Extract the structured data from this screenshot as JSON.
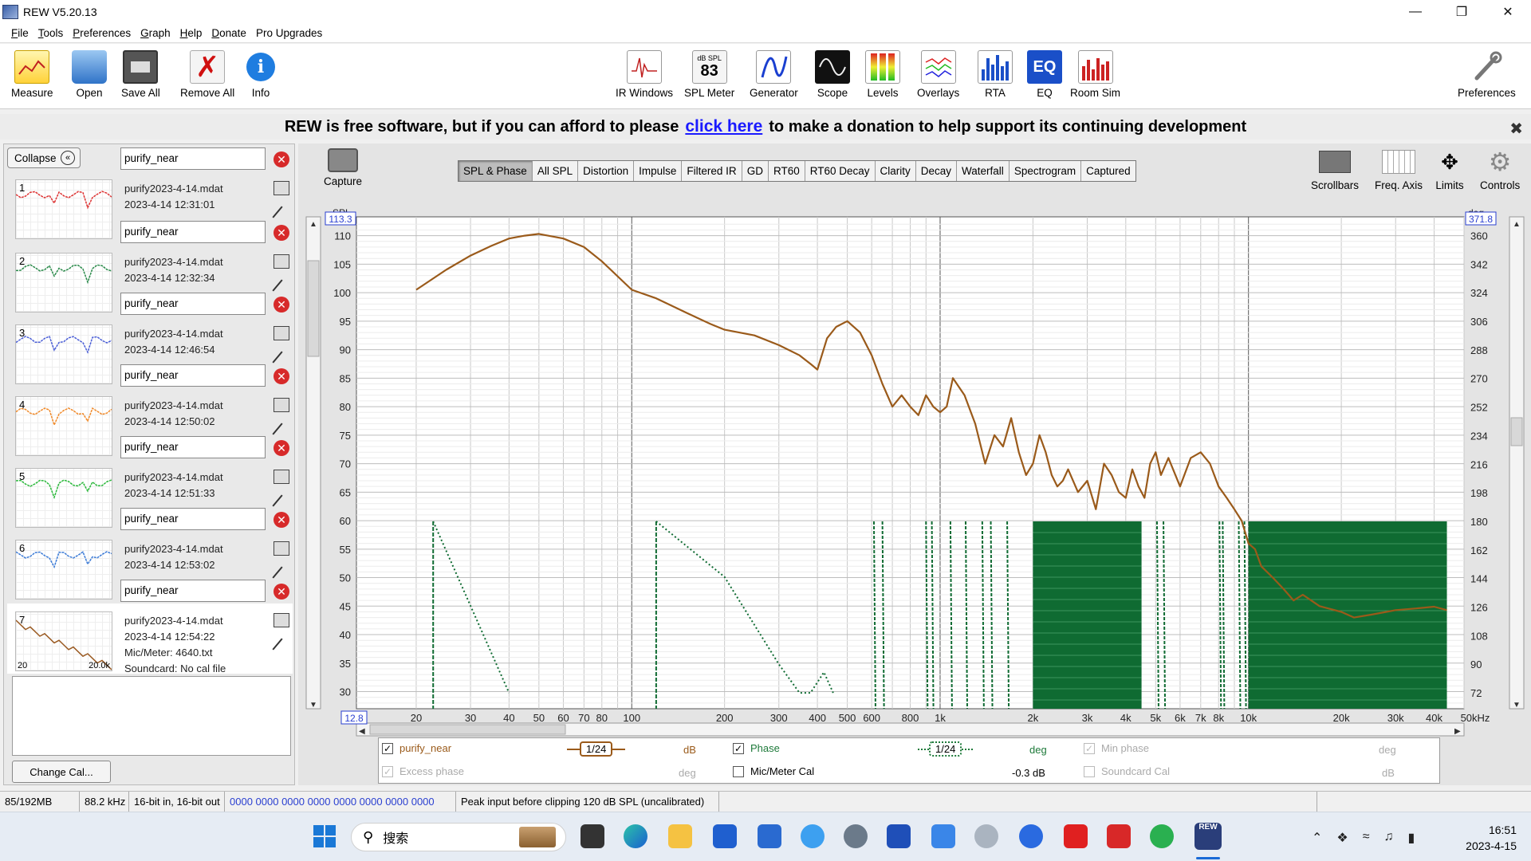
{
  "window": {
    "title": "REW V5.20.13"
  },
  "menu": [
    {
      "label": "File",
      "u": "F",
      "rest": "ile"
    },
    {
      "label": "Tools",
      "u": "T",
      "rest": "ools"
    },
    {
      "label": "Preferences",
      "u": "P",
      "rest": "references"
    },
    {
      "label": "Graph",
      "u": "G",
      "rest": "raph"
    },
    {
      "label": "Help",
      "u": "H",
      "rest": "elp"
    },
    {
      "label": "Donate",
      "u": "D",
      "rest": "onate"
    },
    {
      "label": "Pro Upgrades",
      "u": "",
      "rest": "Pro Upgrades"
    }
  ],
  "toolbar": {
    "measure": "Measure",
    "open": "Open",
    "save_all": "Save All",
    "remove_all": "Remove All",
    "info": "Info",
    "ir_windows": "IR Windows",
    "spl_meter": "SPL Meter",
    "spl_top": "dB SPL",
    "spl_value": "83",
    "generator": "Generator",
    "scope": "Scope",
    "levels": "Levels",
    "overlays": "Overlays",
    "rta": "RTA",
    "eq": "EQ",
    "eq_icon_text": "EQ",
    "room_sim": "Room Sim",
    "preferences": "Preferences"
  },
  "donate": {
    "before": "REW is free software, but if you can afford to please",
    "link": "click here",
    "after": "to make a donation to help support its continuing development"
  },
  "left": {
    "collapse": "Collapse",
    "change_cal": "Change Cal...",
    "measurements": [
      {
        "num": "1",
        "name": "purify_near",
        "file": "purify2023-4-14.mdat",
        "date": "2023-4-14 12:31:01",
        "color": "#d33"
      },
      {
        "num": "2",
        "name": "purify_near",
        "file": "purify2023-4-14.mdat",
        "date": "2023-4-14 12:32:34",
        "color": "#2a8a4a"
      },
      {
        "num": "3",
        "name": "purify_near",
        "file": "purify2023-4-14.mdat",
        "date": "2023-4-14 12:46:54",
        "color": "#4b5fd6"
      },
      {
        "num": "4",
        "name": "purify_near",
        "file": "purify2023-4-14.mdat",
        "date": "2023-4-14 12:50:02",
        "color": "#f08a2a"
      },
      {
        "num": "5",
        "name": "purify_near",
        "file": "purify2023-4-14.mdat",
        "date": "2023-4-14 12:51:33",
        "color": "#2ab83a"
      },
      {
        "num": "6",
        "name": "purify_near",
        "file": "purify2023-4-14.mdat",
        "date": "2023-4-14 12:53:02",
        "color": "#3a7ad6"
      },
      {
        "num": "7",
        "name": "purify_near",
        "file": "purify2023-4-14.mdat",
        "date": "2023-4-14 12:54:22",
        "color": "#9a5a22",
        "mic": "Mic/Meter: 4640.txt",
        "sound": "Soundcard: No cal file"
      }
    ],
    "thumb_ticks": {
      "left": "20",
      "right": "20.0k"
    }
  },
  "graph": {
    "capture": "Capture",
    "tabs": [
      "SPL & Phase",
      "All SPL",
      "Distortion",
      "Impulse",
      "Filtered IR",
      "GD",
      "RT60",
      "RT60 Decay",
      "Clarity",
      "Decay",
      "Waterfall",
      "Spectrogram",
      "Captured"
    ],
    "active_tab": "SPL & Phase",
    "tools": {
      "scrollbars": "Scrollbars",
      "freq_axis": "Freq. Axis",
      "limits": "Limits",
      "controls": "Controls"
    },
    "left_unit": "SPL",
    "right_unit": "deg",
    "left_max_box": "113.3",
    "right_max_box": "371.8",
    "x_min_box": "12.8",
    "y_left_ticks": [
      "110",
      "105",
      "100",
      "95",
      "90",
      "85",
      "80",
      "75",
      "70",
      "65",
      "60",
      "55",
      "50",
      "45",
      "40",
      "35",
      "30"
    ],
    "y_right_ticks": [
      "360",
      "342",
      "324",
      "306",
      "288",
      "270",
      "252",
      "234",
      "216",
      "198",
      "180",
      "162",
      "144",
      "126",
      "108",
      "90",
      "72"
    ],
    "x_ticks": [
      "20",
      "30",
      "40",
      "50",
      "60",
      "70",
      "80",
      "100",
      "200",
      "300",
      "400",
      "500",
      "600",
      "800",
      "1k",
      "2k",
      "3k",
      "4k",
      "5k",
      "6k",
      "7k",
      "8k",
      "10k",
      "20k",
      "30k",
      "40k",
      "50kHz"
    ]
  },
  "chart_data": {
    "type": "line",
    "xlabel": "",
    "ylabel": "SPL",
    "x_scale": "log",
    "xlim": [
      12.8,
      50000
    ],
    "ylim": [
      27,
      113.3
    ],
    "y2label": "deg",
    "y2lim": [
      62,
      371.8
    ],
    "grid": true,
    "series": [
      {
        "name": "purify_near",
        "color": "#9a5a1a",
        "x": [
          20,
          25,
          30,
          35,
          40,
          45,
          50,
          60,
          70,
          80,
          100,
          120,
          150,
          180,
          200,
          250,
          300,
          350,
          380,
          400,
          430,
          460,
          500,
          550,
          600,
          650,
          700,
          750,
          800,
          850,
          900,
          950,
          1000,
          1050,
          1100,
          1200,
          1300,
          1400,
          1500,
          1600,
          1700,
          1800,
          1900,
          2000,
          2100,
          2200,
          2300,
          2400,
          2500,
          2600,
          2800,
          3000,
          3200,
          3400,
          3600,
          3800,
          4000,
          4200,
          4400,
          4600,
          4800,
          5000,
          5200,
          5500,
          6000,
          6500,
          7000,
          7500,
          8000,
          8500,
          9000,
          9500,
          10000,
          10500,
          11000,
          12000,
          13000,
          14000,
          15000,
          17000,
          20000,
          22000,
          25000,
          28000,
          30000,
          35000,
          40000,
          44000
        ],
        "y": [
          100.5,
          104,
          106.5,
          108.2,
          109.5,
          110,
          110.3,
          109.5,
          108,
          105.5,
          100.5,
          99,
          96.5,
          94.5,
          93.5,
          92.5,
          90.8,
          89,
          87.5,
          86.5,
          92,
          94,
          95,
          93,
          89,
          84,
          80,
          82,
          80,
          78.5,
          82,
          80,
          79,
          80,
          85,
          82,
          77,
          70,
          75,
          73,
          78,
          72,
          68,
          70,
          75,
          72,
          68,
          66,
          67,
          69,
          65,
          67,
          62,
          70,
          68,
          65,
          64,
          69,
          66,
          64,
          70,
          72,
          68,
          71,
          66,
          71,
          72,
          70,
          66,
          64,
          62,
          60,
          56,
          55,
          52,
          50,
          48,
          46,
          47,
          45,
          44,
          43,
          43.5,
          44,
          44.3,
          44.6,
          44.9,
          44.3
        ]
      }
    ],
    "phase_segments": [
      {
        "x": [
          22.7,
          40
        ],
        "y2": [
          180,
          72
        ]
      },
      {
        "x": [
          120,
          200,
          300,
          350,
          380,
          420,
          450
        ],
        "y2": [
          180,
          145,
          90,
          72,
          72,
          85,
          72
        ]
      }
    ],
    "phase_dense_regions": [
      [
        2000,
        4500
      ],
      [
        10000,
        44000
      ]
    ],
    "phase_lines": [
      610,
      650,
      900,
      940,
      1080,
      1210,
      1370,
      1460,
      1650,
      5050,
      5300,
      8050,
      8250,
      9300,
      9700
    ]
  },
  "legend": {
    "purify_near": "purify_near",
    "smooth1": "1/24",
    "db": "dB",
    "phase": "Phase",
    "smooth2": "1/24",
    "deg": "deg",
    "min_phase": "Min phase",
    "deg2": "deg",
    "excess_phase": "Excess phase",
    "deg3": "deg",
    "mic_cal": "Mic/Meter Cal",
    "mic_offset": "-0.3 dB",
    "soundcard_cal": "Soundcard Cal",
    "db2": "dB"
  },
  "status": {
    "memory": "85/192MB",
    "rate": "88.2 kHz",
    "bits": "16-bit in, 16-bit out",
    "hex": "0000 0000  0000 0000  0000 0000  0000 0000",
    "peak": "Peak input before clipping 120 dB SPL (uncalibrated)"
  },
  "taskbar": {
    "search": "搜索",
    "time": "16:51",
    "date": "2023-4-15",
    "rew_label": "REW"
  }
}
